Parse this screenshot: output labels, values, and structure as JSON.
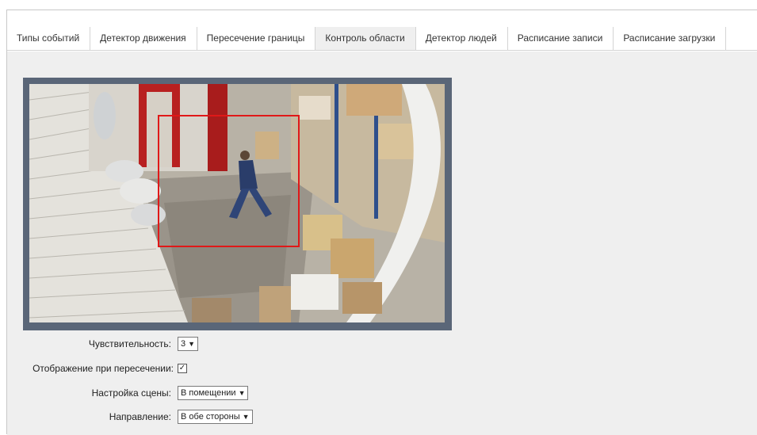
{
  "tabs": [
    {
      "label": "Типы событий",
      "active": false
    },
    {
      "label": "Детектор движения",
      "active": false
    },
    {
      "label": "Пересечение границы",
      "active": false
    },
    {
      "label": "Контроль области",
      "active": true
    },
    {
      "label": "Детектор людей",
      "active": false
    },
    {
      "label": "Расписание записи",
      "active": false
    },
    {
      "label": "Расписание загрузки",
      "active": false
    }
  ],
  "settings": {
    "sensitivity_label": "Чувствительность:",
    "sensitivity_value": "3",
    "display_on_cross_label": "Отображение при пересечении:",
    "display_on_cross_checked": true,
    "display_on_cross_mark": "✓",
    "scene_label": "Настройка сцены:",
    "scene_value": "В помещении",
    "direction_label": "Направление:",
    "direction_value": "В обе стороны",
    "dropdown_icon": "▼"
  },
  "colors": {
    "region_rect": "#e01818",
    "video_border": "#5a6678",
    "active_tab": "#efefef"
  }
}
